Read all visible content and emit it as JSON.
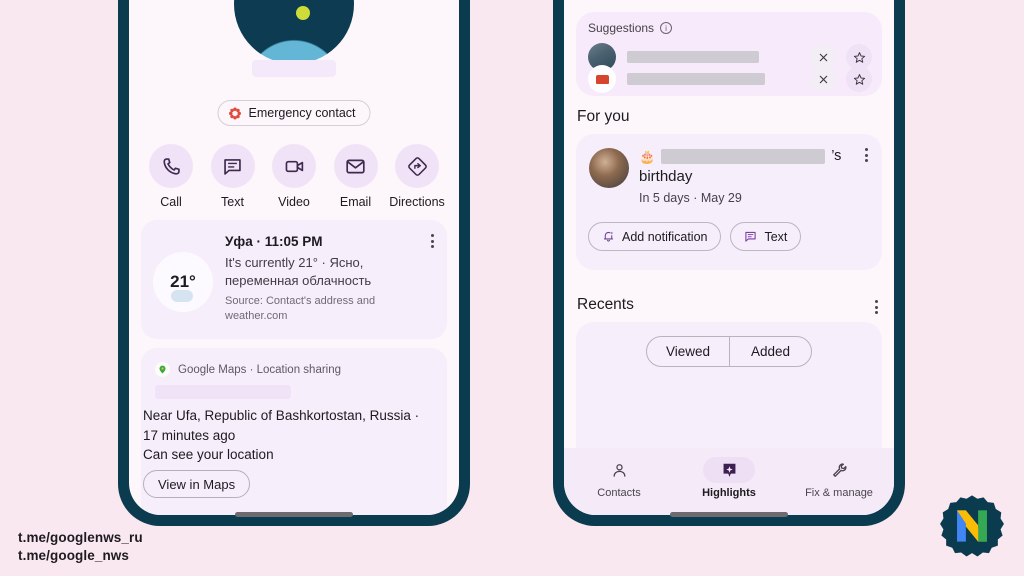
{
  "meta": {
    "background_color": "#fae8f0",
    "phone_frame_color": "#0b3b4e",
    "screen_color": "#fdf7fb",
    "accent_purple": "#6f3f94",
    "card_color": "#f6eefa"
  },
  "watermark": {
    "line1": "t.me/googlenws_ru",
    "line2": "t.me/google_nws"
  },
  "logo": {
    "name": "nws-logo",
    "letter": "N",
    "badge_color": "#0b3b4e",
    "stripe_blue": "#4285f4",
    "stripe_yellow": "#fbbc05",
    "stripe_green": "#34a853"
  },
  "left_phone": {
    "name": "contact-details-screen",
    "avatar": {
      "name": "contact-avatar",
      "redacted": true
    },
    "contact_name_redacted": true,
    "emergency_chip": {
      "label": "Emergency contact",
      "icon": "emergency-flower-icon",
      "icon_color": "#e04a3c"
    },
    "actions": [
      {
        "label": "Call",
        "icon": "phone-icon"
      },
      {
        "label": "Text",
        "icon": "message-icon"
      },
      {
        "label": "Video",
        "icon": "video-camera-icon"
      },
      {
        "label": "Email",
        "icon": "envelope-icon"
      },
      {
        "label": "Directions",
        "icon": "directions-diamond-icon"
      }
    ],
    "weather_card": {
      "name": "weather-card",
      "title": "Уфа · 11:05 PM",
      "temperature": "21°",
      "description": "It's currently 21° · Ясно, переменная облачность",
      "source": "Source: Contact's address and weather.com",
      "overflow_icon": "kebab-menu-icon"
    },
    "maps_card": {
      "name": "location-sharing-card",
      "header": "Google Maps · Location sharing",
      "header_icon": "map-pin-icon",
      "name_redacted": true,
      "body_line1": "Near Ufa, Republic of Bashkortostan, Russia ·",
      "body_line2": "17 minutes ago",
      "body_line3": "Can see your location",
      "button": "View in Maps"
    }
  },
  "right_phone": {
    "name": "highlights-screen",
    "suggestions": {
      "name": "suggestions-card",
      "title": "Suggestions",
      "info_icon": "info-icon",
      "rows": [
        {
          "avatar": "person-photo-avatar",
          "name_redacted": true,
          "dismiss_icon": "close-icon",
          "favorite_icon": "star-outline-icon"
        },
        {
          "avatar": "brand-logo-avatar",
          "name_redacted": true,
          "dismiss_icon": "close-icon",
          "favorite_icon": "star-outline-icon"
        }
      ]
    },
    "for_you": {
      "title": "For you",
      "card": {
        "name": "birthday-card",
        "avatar": "contact-photo-avatar",
        "emoji": "🎂",
        "name_redacted": true,
        "possessive": "’s",
        "event": "birthday",
        "when": "In 5 days · May 29",
        "overflow_icon": "kebab-menu-icon",
        "buttons": [
          {
            "label": "Add notification",
            "icon": "bell-sparkle-icon"
          },
          {
            "label": "Text",
            "icon": "message-bubble-icon"
          }
        ]
      }
    },
    "recents": {
      "title": "Recents",
      "overflow_icon": "kebab-menu-icon",
      "tabs": [
        {
          "label": "Viewed",
          "selected": true
        },
        {
          "label": "Added",
          "selected": false
        }
      ]
    },
    "bottom_nav": [
      {
        "label": "Contacts",
        "icon": "person-outline-icon",
        "active": false
      },
      {
        "label": "Highlights",
        "icon": "highlight-badge-icon",
        "active": true
      },
      {
        "label": "Fix & manage",
        "icon": "wrench-icon",
        "active": false
      }
    ]
  }
}
